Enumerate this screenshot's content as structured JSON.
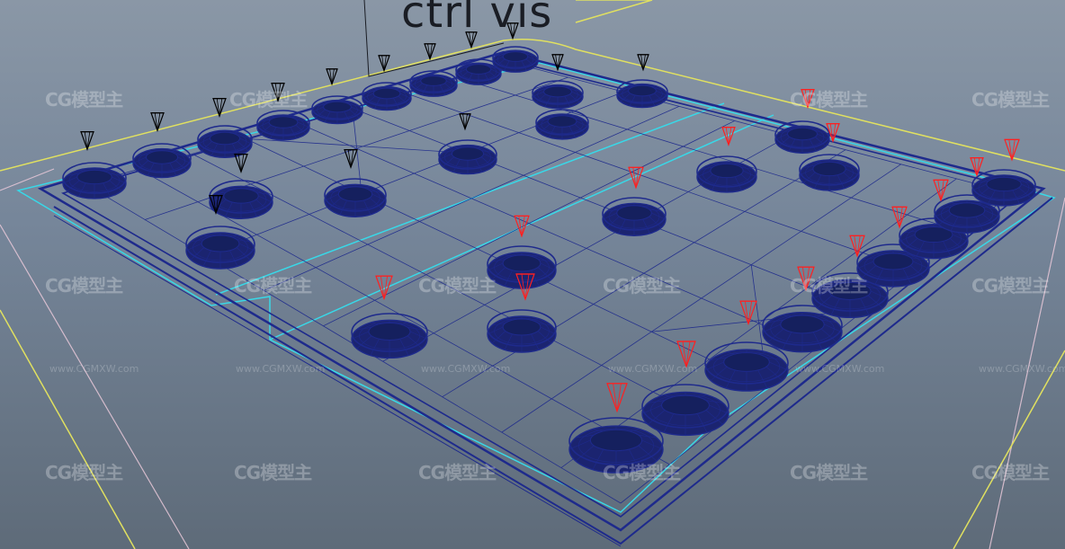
{
  "viewport": {
    "control_label": "ctrl vis",
    "watermark_text": "CG模型主",
    "watermark_url": "www.CGMXW.com",
    "colors": {
      "background_top": "#8a97a6",
      "background_bottom": "#5e6b79",
      "wireframe": "#1e2a8c",
      "safe_frame_yellow": "#e0e060",
      "board_outline_cyan": "#38d8e8",
      "grid_pink": "#e8c8d8",
      "control_black": "#000000",
      "control_red": "#ff2020"
    },
    "pieces": {
      "player_one_count": 16,
      "player_two_count": 16
    }
  }
}
